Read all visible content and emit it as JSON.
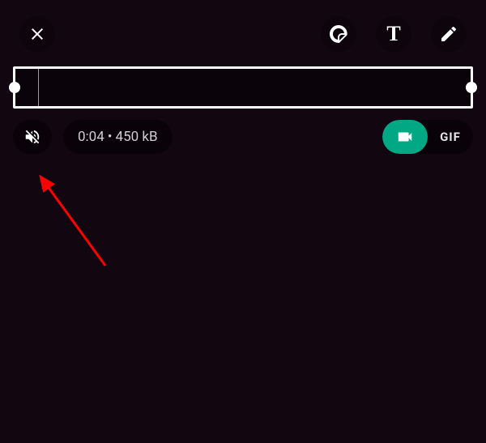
{
  "media": {
    "duration": "0:04",
    "separator": "•",
    "size": "450 kB"
  },
  "toggle": {
    "gif_label": "GIF"
  },
  "tools": {
    "text_glyph": "T"
  }
}
